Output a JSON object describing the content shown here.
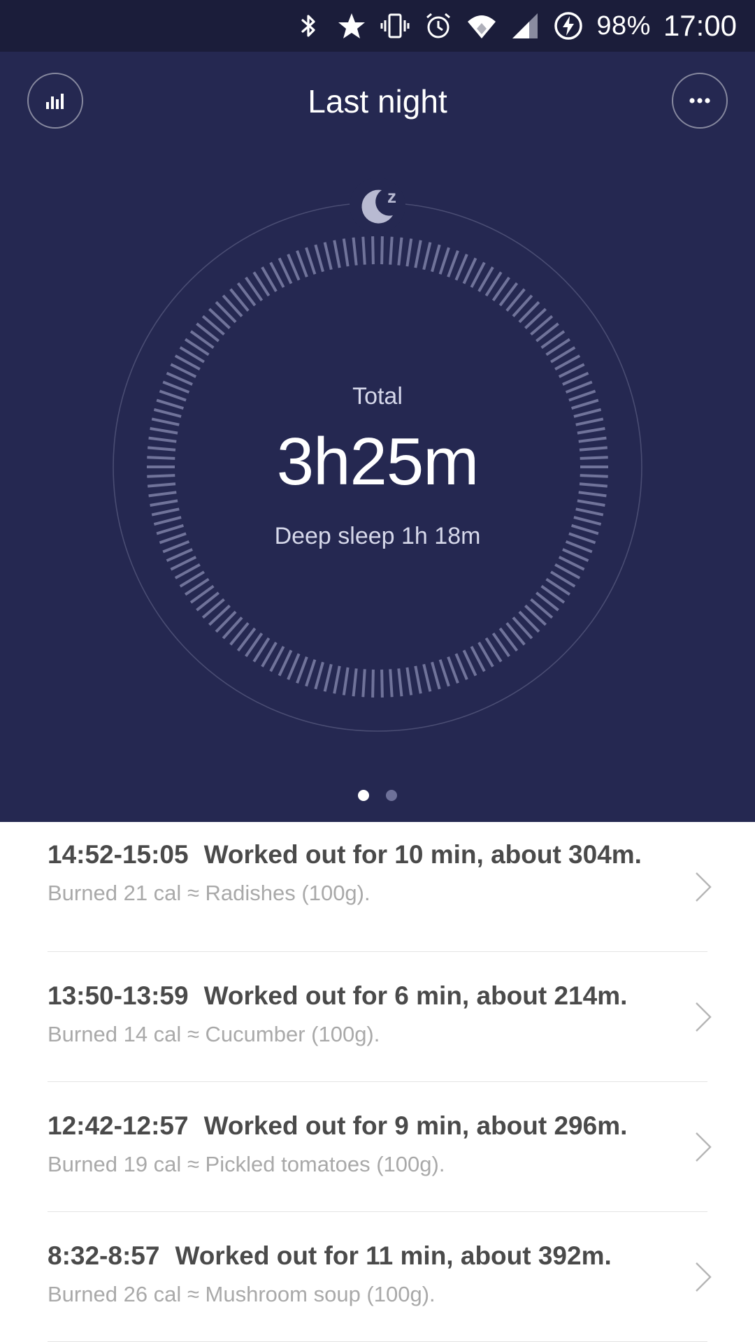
{
  "status_bar": {
    "battery": "98%",
    "time": "17:00",
    "icons": [
      "bluetooth-icon",
      "star-icon",
      "vibrate-icon",
      "alarm-icon",
      "wifi-icon",
      "signal-icon",
      "battery-charging-icon"
    ]
  },
  "header": {
    "title": "Last night",
    "left_button_icon": "bar-chart-icon",
    "right_button_icon": "more-icon"
  },
  "sleep": {
    "total_label": "Total",
    "total_value": "3h25m",
    "deep_sleep": "Deep sleep 1h 18m",
    "icon": "moon-sleep-icon"
  },
  "pager": {
    "pages": 2,
    "active": 0
  },
  "activities": [
    {
      "time": "14:52-15:05",
      "title": "Worked out for 10 min, about 304m.",
      "subtitle": "Burned 21 cal ≈ Radishes (100g)."
    },
    {
      "time": "13:50-13:59",
      "title": "Worked out for 6 min, about 214m.",
      "subtitle": "Burned 14 cal ≈ Cucumber (100g)."
    },
    {
      "time": "12:42-12:57",
      "title": "Worked out for 9 min, about 296m.",
      "subtitle": "Burned 19 cal ≈ Pickled tomatoes (100g)."
    },
    {
      "time": "8:32-8:57",
      "title": "Worked out for 11 min, about 392m.",
      "subtitle": "Burned 26 cal ≈ Mushroom soup (100g)."
    }
  ],
  "colors": {
    "status_bar_bg": "#1b1d3a",
    "hero_bg": "#252851",
    "tick": "#70739a",
    "list_title": "#4a4a4a",
    "list_subtitle": "#a9a9a9"
  }
}
